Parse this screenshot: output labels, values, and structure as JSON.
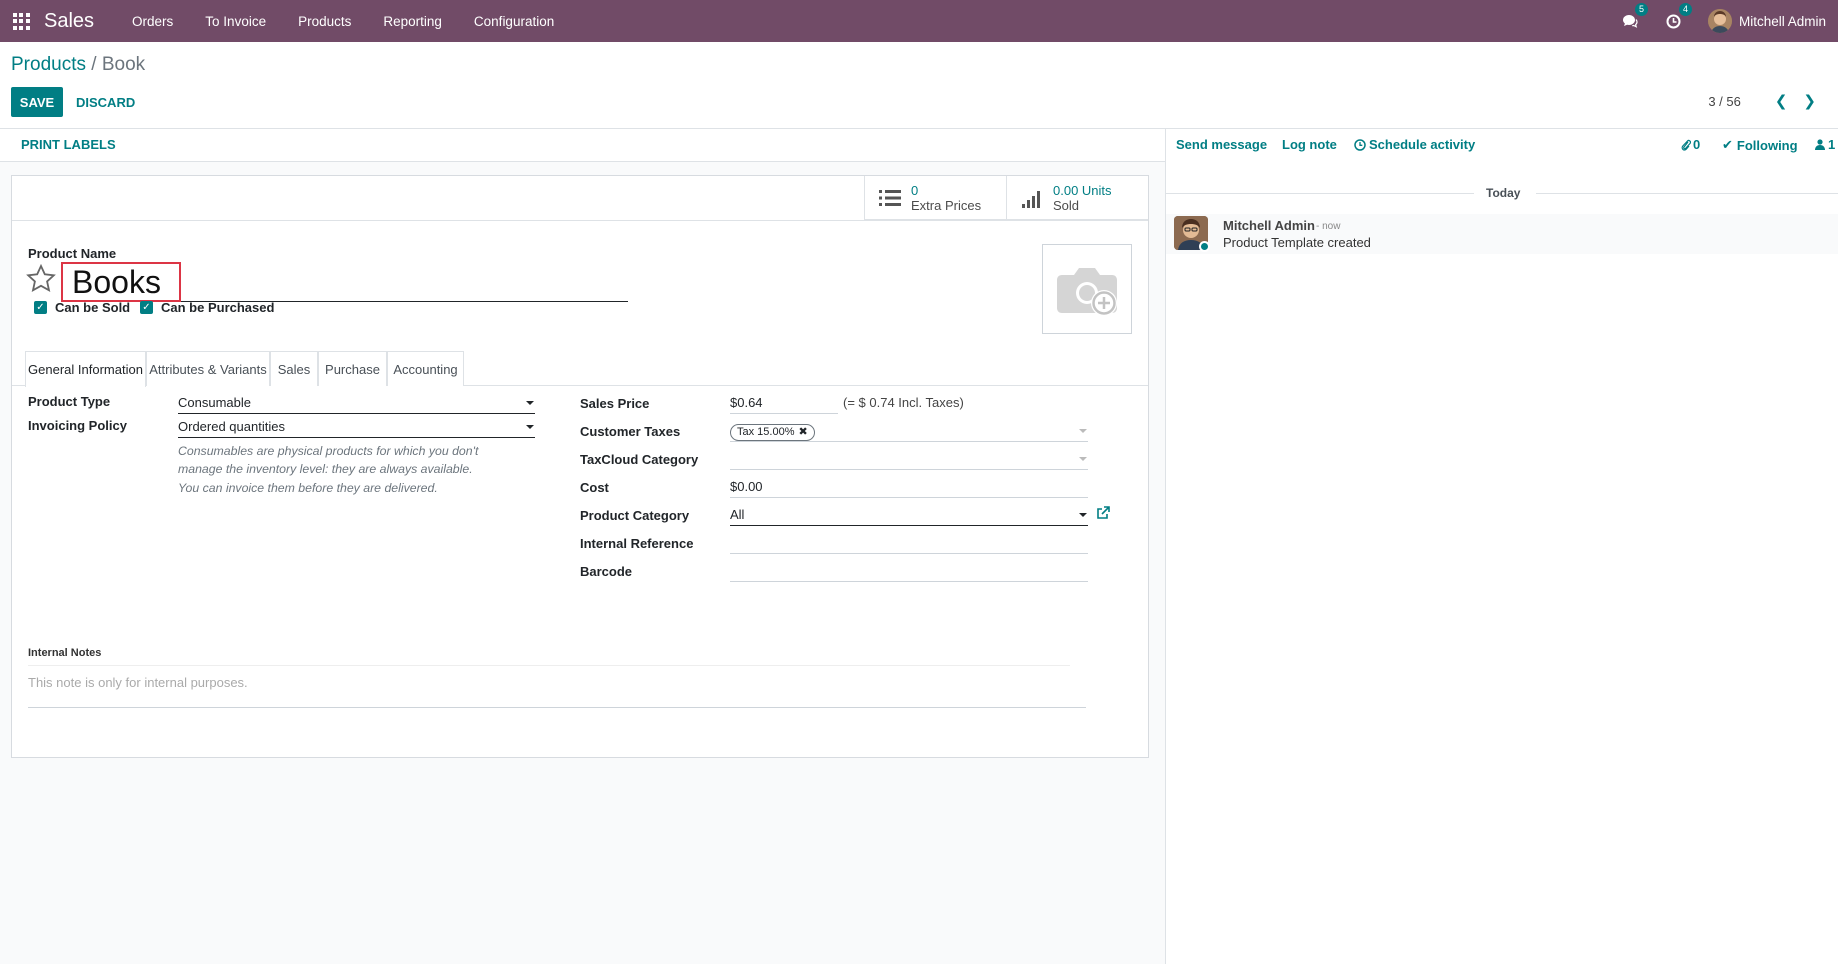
{
  "navbar": {
    "app_name": "Sales",
    "menu": [
      "Orders",
      "To Invoice",
      "Products",
      "Reporting",
      "Configuration"
    ],
    "messages_count": "5",
    "activities_count": "4",
    "user_name": "Mitchell Admin",
    "color": "#714b67"
  },
  "control_panel": {
    "breadcrumb_parent": "Products",
    "breadcrumb_separator": "/",
    "breadcrumb_current": "Book",
    "save_label": "SAVE",
    "discard_label": "DISCARD",
    "pager_value": "3 / 56"
  },
  "statusbar": {
    "print_labels": "PRINT LABELS"
  },
  "smart_buttons": {
    "extra_prices_value": "0",
    "extra_prices_label": "Extra Prices",
    "sold_value": "0.00 Units",
    "sold_label": "Sold"
  },
  "product": {
    "name_label": "Product Name",
    "name_value": "Books",
    "can_be_sold_label": "Can be Sold",
    "can_be_sold": true,
    "can_be_purchased_label": "Can be Purchased",
    "can_be_purchased": true
  },
  "tabs": [
    "General Information",
    "Attributes & Variants",
    "Sales",
    "Purchase",
    "Accounting"
  ],
  "general": {
    "product_type_label": "Product Type",
    "product_type_value": "Consumable",
    "invoicing_policy_label": "Invoicing Policy",
    "invoicing_policy_value": "Ordered quantities",
    "help_1": "Consumables are physical products for which you don't manage the inventory level: they are always available.",
    "help_2": "You can invoice them before they are delivered.",
    "sales_price_label": "Sales Price",
    "sales_price_currency": "$",
    "sales_price_value": "0.64",
    "sales_price_incl": "(= $ 0.74 Incl. Taxes)",
    "customer_taxes_label": "Customer Taxes",
    "customer_tax_tag": "Tax 15.00%",
    "taxcloud_label": "TaxCloud Category",
    "cost_label": "Cost",
    "cost_currency": "$",
    "cost_value": "0.00",
    "category_label": "Product Category",
    "category_value": "All",
    "internal_ref_label": "Internal Reference",
    "barcode_label": "Barcode",
    "notes_label": "Internal Notes",
    "notes_placeholder": "This note is only for internal purposes."
  },
  "chatter": {
    "send_message": "Send message",
    "log_note": "Log note",
    "schedule_activity": "Schedule activity",
    "attachments_count": "0",
    "following": "Following",
    "followers_count": "1",
    "today": "Today",
    "message_author": "Mitchell Admin",
    "message_date": "- now",
    "message_body": "Product Template created"
  },
  "colors": {
    "primary": "#017e84",
    "brand": "#714b67",
    "highlight": "#dc3545"
  }
}
